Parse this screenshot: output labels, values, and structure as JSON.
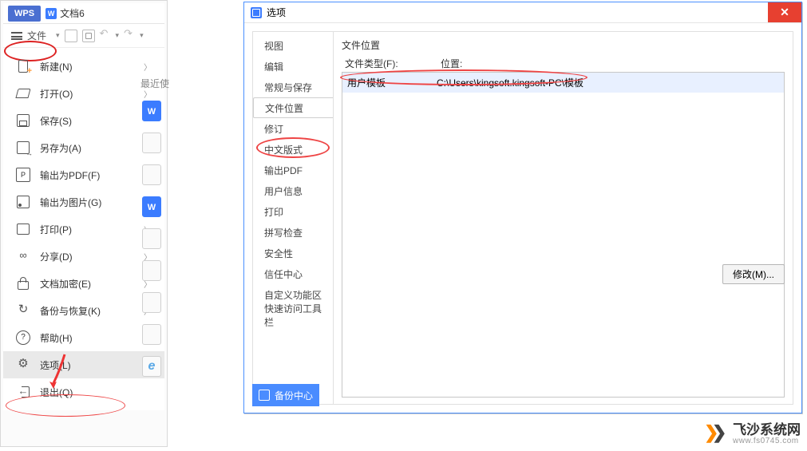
{
  "tabstrip": {
    "wps": "WPS",
    "doc": "文档6"
  },
  "toolbar": {
    "file": "文件"
  },
  "filemenu": {
    "items": [
      {
        "label": "新建(N)",
        "icon": "i-new",
        "chev": true
      },
      {
        "label": "打开(O)",
        "icon": "i-open",
        "chev": true
      },
      {
        "label": "保存(S)",
        "icon": "i-save",
        "chev": false
      },
      {
        "label": "另存为(A)",
        "icon": "i-saveas",
        "chev": true
      },
      {
        "label": "输出为PDF(F)",
        "icon": "i-pdf",
        "chev": false
      },
      {
        "label": "输出为图片(G)",
        "icon": "i-img",
        "chev": false
      },
      {
        "label": "打印(P)",
        "icon": "i-print",
        "chev": true
      },
      {
        "label": "分享(D)",
        "icon": "i-share",
        "chev": true
      },
      {
        "label": "文档加密(E)",
        "icon": "i-lock",
        "chev": true
      },
      {
        "label": "备份与恢复(K)",
        "icon": "i-backup",
        "chev": true
      },
      {
        "label": "帮助(H)",
        "icon": "i-help",
        "chev": true
      },
      {
        "label": "选项(L)",
        "icon": "i-gear",
        "chev": false,
        "sel": true
      },
      {
        "label": "退出(Q)",
        "icon": "i-exit",
        "chev": false
      }
    ]
  },
  "recent_header": "最近使",
  "dialog": {
    "title": "选项",
    "categories": [
      "视图",
      "编辑",
      "常规与保存",
      "文件位置",
      "修订",
      "中文版式",
      "输出PDF",
      "用户信息",
      "打印",
      "拼写检查",
      "安全性",
      "信任中心",
      "自定义功能区",
      "快速访问工具栏"
    ],
    "selected_category_index": 3,
    "section_title": "文件位置",
    "col_type": "文件类型(F):",
    "col_loc": "位置:",
    "rows": [
      {
        "type": "用户模板",
        "loc": "C:\\Users\\kingsoft.kingsoft-PC\\模板"
      }
    ],
    "modify": "修改(M)...",
    "backup": "备份中心"
  },
  "watermark": {
    "brand": "飞沙系统网",
    "url": "www.fs0745.com"
  }
}
